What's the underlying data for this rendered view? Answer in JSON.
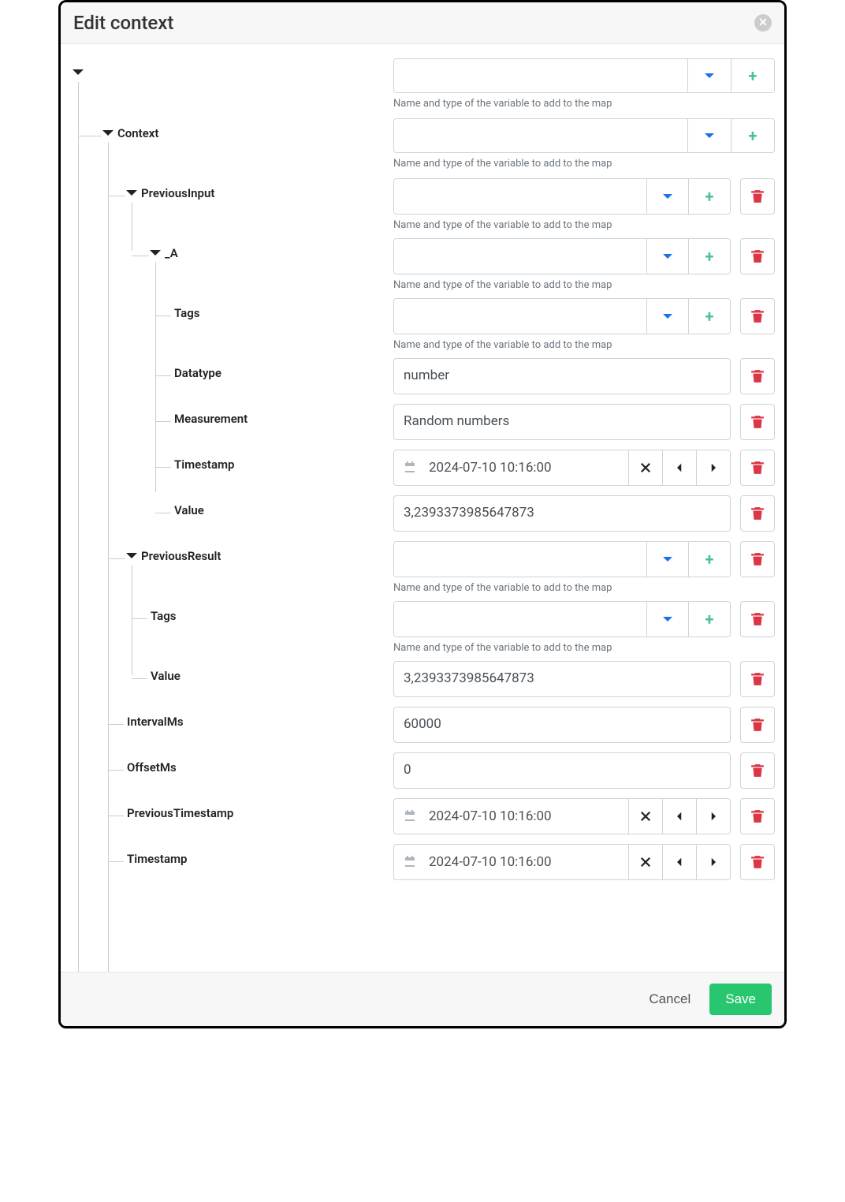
{
  "dialog": {
    "title": "Edit context",
    "helper": "Name and type of the variable to add to the map",
    "cancel": "Cancel",
    "save": "Save"
  },
  "tree": {
    "root": {
      "context": {
        "label": "Context",
        "previousInput": {
          "label": "PreviousInput",
          "a": {
            "label": "_A",
            "tags": {
              "label": "Tags"
            },
            "datatype": {
              "label": "Datatype",
              "value": "number"
            },
            "measurement": {
              "label": "Measurement",
              "value": "Random numbers"
            },
            "timestamp": {
              "label": "Timestamp",
              "value": "2024-07-10 10:16:00"
            },
            "value": {
              "label": "Value",
              "value": "3,2393373985647873"
            }
          }
        },
        "previousResult": {
          "label": "PreviousResult",
          "tags": {
            "label": "Tags"
          },
          "value": {
            "label": "Value",
            "value": "3,2393373985647873"
          }
        },
        "intervalMs": {
          "label": "IntervalMs",
          "value": "60000"
        },
        "offsetMs": {
          "label": "OffsetMs",
          "value": "0"
        },
        "previousTimestamp": {
          "label": "PreviousTimestamp",
          "value": "2024-07-10 10:16:00"
        },
        "timestamp": {
          "label": "Timestamp",
          "value": "2024-07-10 10:16:00"
        }
      }
    }
  }
}
